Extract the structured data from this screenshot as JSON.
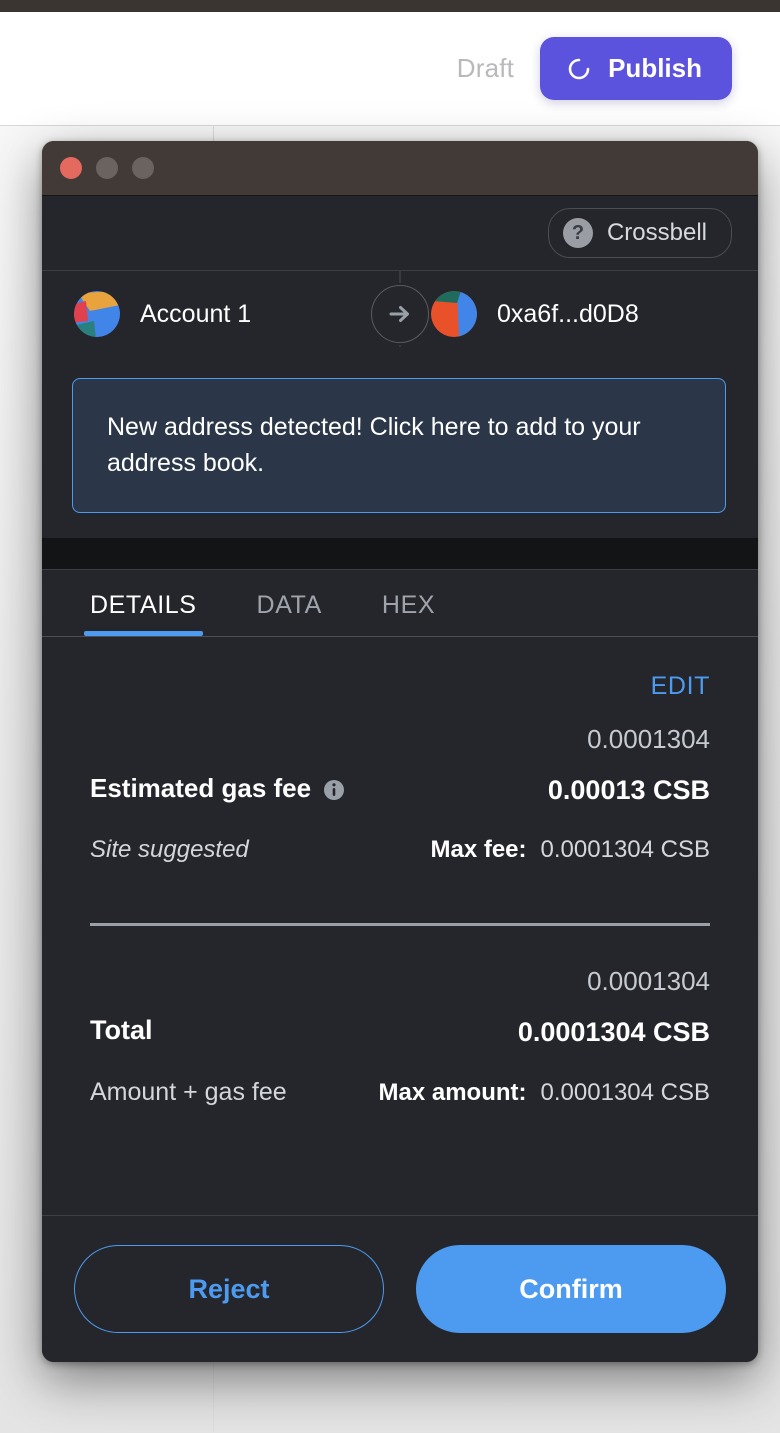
{
  "background_page": {
    "status_label": "Draft",
    "publish_button_label": "Publish",
    "publish_icon": "spinner-icon",
    "accent_color": "#5b52dd"
  },
  "wallet_window": {
    "titlebar": {
      "close_label": "",
      "minimize_label": "",
      "maximize_label": ""
    },
    "network": {
      "icon": "question-mark-icon",
      "icon_glyph": "?",
      "name": "Crossbell"
    },
    "transfer": {
      "from_account": "Account 1",
      "to_account": "0xa6f...d0D8",
      "direction_icon": "arrow-right-icon"
    },
    "banner": {
      "text": "New address detected! Click here to add to your address book.",
      "border_color": "#4d9bf0",
      "background_color": "#2b3748"
    },
    "tabs": [
      {
        "label": "DETAILS",
        "active": true
      },
      {
        "label": "DATA",
        "active": false
      },
      {
        "label": "HEX",
        "active": false
      }
    ],
    "details": {
      "edit_label": "EDIT",
      "gas_fee": {
        "label": "Estimated gas fee",
        "info_icon": "info-icon",
        "alt_value": "0.0001304",
        "primary_value": "0.00013 CSB",
        "source": "Site suggested",
        "max_fee_label": "Max fee:",
        "max_fee_value": "0.0001304 CSB"
      },
      "total": {
        "label": "Total",
        "alt_value": "0.0001304",
        "primary_value": "0.0001304 CSB",
        "sub_label": "Amount + gas fee",
        "max_amount_label": "Max amount:",
        "max_amount_value": "0.0001304 CSB"
      }
    },
    "footer": {
      "reject_label": "Reject",
      "confirm_label": "Confirm",
      "confirm_color": "#4d9bf0"
    }
  }
}
